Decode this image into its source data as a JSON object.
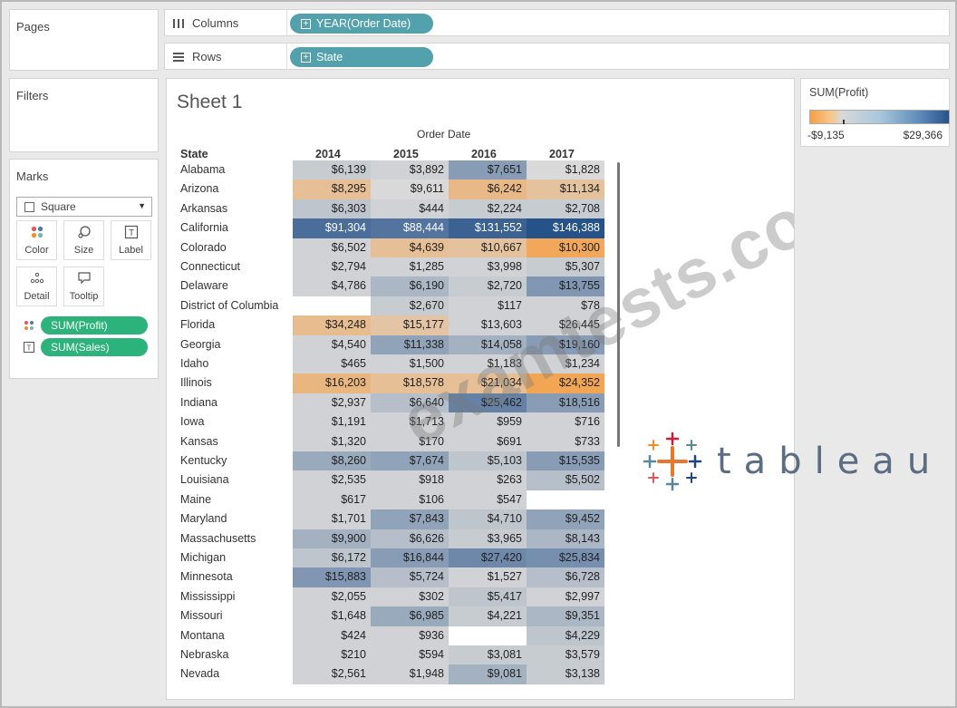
{
  "panels": {
    "pages": "Pages",
    "filters": "Filters",
    "marks": "Marks"
  },
  "shelves": {
    "columns": {
      "label": "Columns",
      "pill": "YEAR(Order Date)"
    },
    "rows": {
      "label": "Rows",
      "pill": "State"
    }
  },
  "marks": {
    "type": "Square",
    "buttons": {
      "color": "Color",
      "size": "Size",
      "label": "Label",
      "detail": "Detail",
      "tooltip": "Tooltip"
    },
    "pills": [
      "SUM(Profit)",
      "SUM(Sales)"
    ]
  },
  "sheet": {
    "title": "Sheet 1",
    "column_group_header": "Order Date",
    "row_header": "State",
    "years": [
      "2014",
      "2015",
      "2016",
      "2017"
    ]
  },
  "legend": {
    "title": "SUM(Profit)",
    "min": "-$9,135",
    "max": "$29,366"
  },
  "watermark": "examtests.com",
  "logo_word": "tableau",
  "colors": {
    "pill_blue": "#52a1ad",
    "pill_green": "#2cb27b",
    "neg": "#f59f44",
    "pos": "#26528a",
    "neutral": "#d9d9d9"
  },
  "chart_data": {
    "type": "table",
    "columns": [
      "2014",
      "2015",
      "2016",
      "2017"
    ],
    "rows": [
      {
        "state": "Alabama",
        "sales": [
          "$6,139",
          "$3,892",
          "$7,651",
          "$1,828"
        ],
        "profit": [
          0.1,
          0.05,
          0.45,
          0.0
        ]
      },
      {
        "state": "Arizona",
        "sales": [
          "$8,295",
          "$9,611",
          "$6,242",
          "$11,134"
        ],
        "profit": [
          -0.45,
          0.0,
          -0.55,
          -0.4
        ]
      },
      {
        "state": "Arkansas",
        "sales": [
          "$6,303",
          "$444",
          "$2,224",
          "$2,708"
        ],
        "profit": [
          0.15,
          0.05,
          0.1,
          0.1
        ]
      },
      {
        "state": "California",
        "sales": [
          "$91,304",
          "$88,444",
          "$131,552",
          "$146,388"
        ],
        "profit": [
          0.8,
          0.75,
          0.88,
          1.0
        ]
      },
      {
        "state": "Colorado",
        "sales": [
          "$6,502",
          "$4,639",
          "$10,667",
          "$10,300"
        ],
        "profit": [
          0.05,
          -0.45,
          -0.4,
          -0.85
        ]
      },
      {
        "state": "Connecticut",
        "sales": [
          "$2,794",
          "$1,285",
          "$3,998",
          "$5,307"
        ],
        "profit": [
          0.05,
          0.05,
          0.05,
          0.1
        ]
      },
      {
        "state": "Delaware",
        "sales": [
          "$4,786",
          "$6,190",
          "$2,720",
          "$13,755"
        ],
        "profit": [
          0.05,
          0.25,
          0.1,
          0.5
        ]
      },
      {
        "state": "District of Columbia",
        "sales": [
          "",
          "$2,670",
          "$117",
          "$78"
        ],
        "profit": [
          null,
          0.1,
          0.05,
          0.05
        ]
      },
      {
        "state": "Florida",
        "sales": [
          "$34,248",
          "$15,177",
          "$13,603",
          "$26,445"
        ],
        "profit": [
          -0.5,
          -0.35,
          0.05,
          0.05
        ]
      },
      {
        "state": "Georgia",
        "sales": [
          "$4,540",
          "$11,338",
          "$14,058",
          "$19,160"
        ],
        "profit": [
          0.05,
          0.4,
          0.3,
          0.45
        ]
      },
      {
        "state": "Idaho",
        "sales": [
          "$465",
          "$1,500",
          "$1,183",
          "$1,234"
        ],
        "profit": [
          0.05,
          0.05,
          0.05,
          0.05
        ]
      },
      {
        "state": "Illinois",
        "sales": [
          "$16,203",
          "$18,578",
          "$21,034",
          "$24,352"
        ],
        "profit": [
          -0.6,
          -0.45,
          -0.45,
          -0.9
        ]
      },
      {
        "state": "Indiana",
        "sales": [
          "$2,937",
          "$6,640",
          "$25,462",
          "$18,516"
        ],
        "profit": [
          0.05,
          0.2,
          0.65,
          0.45
        ]
      },
      {
        "state": "Iowa",
        "sales": [
          "$1,191",
          "$1,713",
          "$959",
          "$716"
        ],
        "profit": [
          0.05,
          0.05,
          0.05,
          0.05
        ]
      },
      {
        "state": "Kansas",
        "sales": [
          "$1,320",
          "$170",
          "$691",
          "$733"
        ],
        "profit": [
          0.05,
          0.05,
          0.05,
          0.05
        ]
      },
      {
        "state": "Kentucky",
        "sales": [
          "$8,260",
          "$7,674",
          "$5,103",
          "$15,535"
        ],
        "profit": [
          0.35,
          0.4,
          0.15,
          0.45
        ]
      },
      {
        "state": "Louisiana",
        "sales": [
          "$2,535",
          "$918",
          "$263",
          "$5,502"
        ],
        "profit": [
          0.05,
          0.05,
          0.05,
          0.2
        ]
      },
      {
        "state": "Maine",
        "sales": [
          "$617",
          "$106",
          "$547",
          ""
        ],
        "profit": [
          0.05,
          0.05,
          0.05,
          null
        ]
      },
      {
        "state": "Maryland",
        "sales": [
          "$1,701",
          "$7,843",
          "$4,710",
          "$9,452"
        ],
        "profit": [
          0.05,
          0.4,
          0.15,
          0.4
        ]
      },
      {
        "state": "Massachusetts",
        "sales": [
          "$9,900",
          "$6,626",
          "$3,965",
          "$8,143"
        ],
        "profit": [
          0.3,
          0.2,
          0.1,
          0.25
        ]
      },
      {
        "state": "Michigan",
        "sales": [
          "$6,172",
          "$16,844",
          "$27,420",
          "$25,834"
        ],
        "profit": [
          0.15,
          0.45,
          0.6,
          0.55
        ]
      },
      {
        "state": "Minnesota",
        "sales": [
          "$15,883",
          "$5,724",
          "$1,527",
          "$6,728"
        ],
        "profit": [
          0.5,
          0.2,
          0.05,
          0.2
        ]
      },
      {
        "state": "Mississippi",
        "sales": [
          "$2,055",
          "$302",
          "$5,417",
          "$2,997"
        ],
        "profit": [
          0.05,
          0.05,
          0.15,
          0.05
        ]
      },
      {
        "state": "Missouri",
        "sales": [
          "$1,648",
          "$6,985",
          "$4,221",
          "$9,351"
        ],
        "profit": [
          0.05,
          0.35,
          0.1,
          0.25
        ]
      },
      {
        "state": "Montana",
        "sales": [
          "$424",
          "$936",
          "",
          "$4,229"
        ],
        "profit": [
          0.05,
          0.05,
          null,
          0.15
        ]
      },
      {
        "state": "Nebraska",
        "sales": [
          "$210",
          "$594",
          "$3,081",
          "$3,579"
        ],
        "profit": [
          0.05,
          0.05,
          0.1,
          0.1
        ]
      },
      {
        "state": "Nevada",
        "sales": [
          "$2,561",
          "$1,948",
          "$9,081",
          "$3,138"
        ],
        "profit": [
          0.05,
          0.05,
          0.3,
          0.1
        ]
      }
    ]
  }
}
